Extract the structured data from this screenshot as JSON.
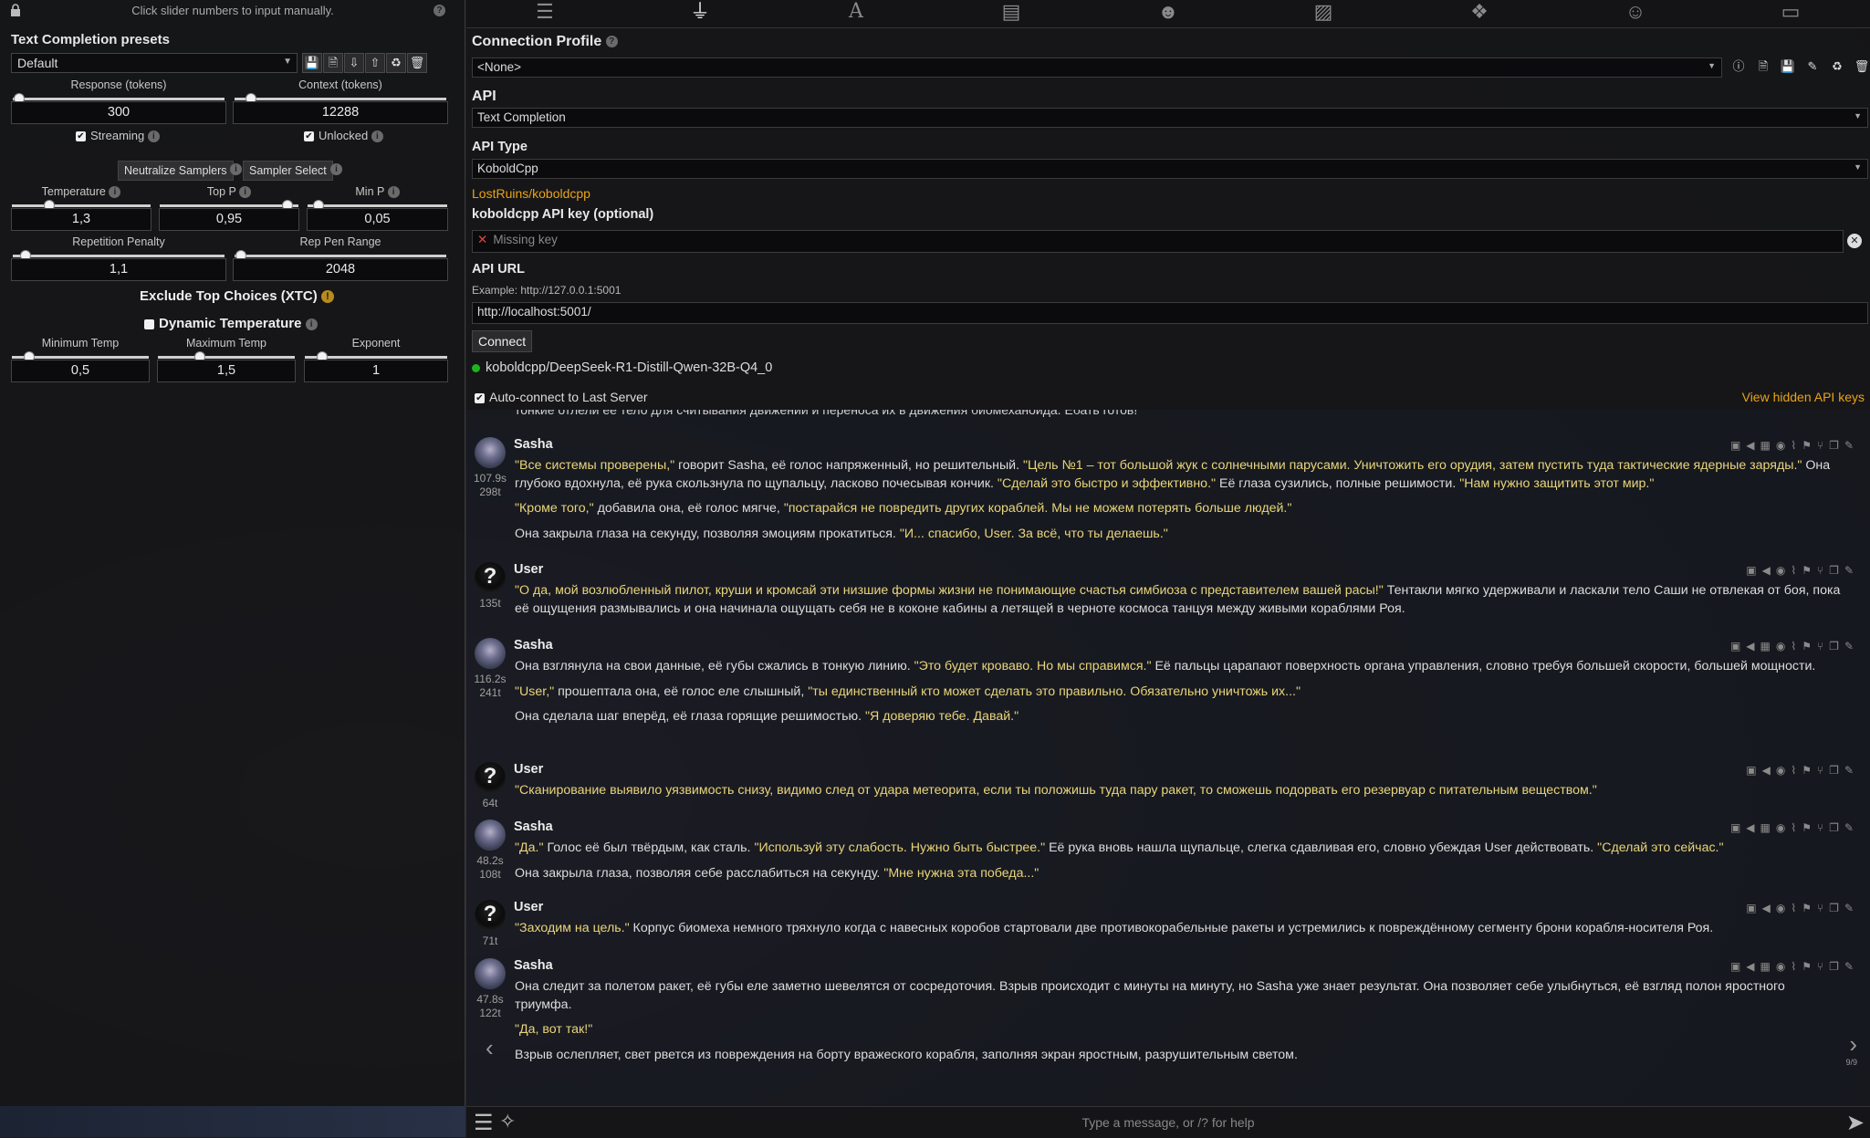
{
  "left_panel": {
    "hint": "Click slider numbers to input manually.",
    "presets_title": "Text Completion presets",
    "preset_value": "Default",
    "response_label": "Response (tokens)",
    "response_value": "300",
    "response_level": 0.05,
    "context_label": "Context (tokens)",
    "context_value": "12288",
    "context_level": 0.08,
    "streaming_label": "Streaming",
    "streaming_checked": true,
    "unlocked_label": "Unlocked",
    "unlocked_checked": true,
    "neutralize_label": "Neutralize Samplers",
    "sampler_select_label": "Sampler Select",
    "temperature_label": "Temperature",
    "temperature_value": "1,3",
    "top_p_label": "Top P",
    "top_p_value": "0,95",
    "min_p_label": "Min P",
    "min_p_value": "0,05",
    "rep_pen_label": "Repetition Penalty",
    "rep_pen_value": "1,1",
    "rep_pen_range_label": "Rep Pen Range",
    "rep_pen_range_value": "2048",
    "xtc_label": "Exclude Top Choices (XTC)",
    "dynamic_temp_label": "Dynamic Temperature",
    "dynamic_temp_checked": false,
    "min_temp_label": "Minimum Temp",
    "min_temp_value": "0,5",
    "max_temp_label": "Maximum Temp",
    "max_temp_value": "1,5",
    "exponent_label": "Exponent",
    "exponent_value": "1"
  },
  "connection": {
    "profile_title": "Connection Profile",
    "profile_value": "<None>",
    "api_title": "API",
    "api_value": "Text Completion",
    "api_type_title": "API Type",
    "api_type_value": "KoboldCpp",
    "repo_link": "LostRuins/koboldcpp",
    "key_title": "koboldcpp API key (optional)",
    "key_placeholder": "Missing key",
    "url_title": "API URL",
    "url_example": "Example: http://127.0.0.1:5001",
    "url_value": "http://localhost:5001/",
    "connect_label": "Connect",
    "model_status": "koboldcpp/DeepSeek-R1-Distill-Qwen-32B-Q4_0",
    "status_color": "#1db31d",
    "autoconnect_label": "Auto-connect to Last Server",
    "autoconnect_checked": true,
    "hidden_keys_label": "View hidden API keys"
  },
  "nav_icons": [
    "sliders-icon",
    "plug-icon",
    "font-icon",
    "book-icon",
    "user-cog-icon",
    "image-icon",
    "cubes-icon",
    "smile-icon",
    "id-card-icon"
  ],
  "chat": {
    "cut_line": "тонкие отлели ее тело для считывания движений и переноса их в движения биомеханоида. Ебать готов!",
    "messages": [
      {
        "name": "Sasha",
        "time": "107.9s",
        "tokens": "298t",
        "paras": [
          [
            {
              "t": "\"Все системы проверены,\"",
              "q": true
            },
            {
              "t": " говорит Sasha, её голос напряженный, но решительный. ",
              "q": false
            },
            {
              "t": "\"Цель №1 – тот большой жук с солнечными парусами. Уничтожить его орудия, затем пустить туда тактические ядерные заряды.\"",
              "q": true
            },
            {
              "t": " Она глубоко вдохнула, её рука скользнула по щупальцу, ласково почесывая кончик. ",
              "q": false
            },
            {
              "t": "\"Сделай это быстро и эффективно.\"",
              "q": true
            },
            {
              "t": " Её глаза сузились, полные решимости. ",
              "q": false
            },
            {
              "t": "\"Нам нужно защитить этот мир.\"",
              "q": true
            }
          ],
          [
            {
              "t": "\"Кроме того,\"",
              "q": true
            },
            {
              "t": " добавила она, её голос мягче, ",
              "q": false
            },
            {
              "t": "\"постарайся не повредить других кораблей. Мы не можем потерять больше людей.\"",
              "q": true
            }
          ],
          [
            {
              "t": "Она закрыла глаза на секунду, позволяя эмоциям прокатиться. ",
              "q": false
            },
            {
              "t": "\"И... спасибо, User. За всё, что ты делаешь.\"",
              "q": true
            }
          ]
        ]
      },
      {
        "name": "User",
        "time": "",
        "tokens": "135t",
        "paras": [
          [
            {
              "t": "\"О да, мой возлюбленный пилот, круши и кромсай эти низшие формы жизни не понимающие счастья симбиоза с представителем вашей расы!\"",
              "q": true
            },
            {
              "t": " Тентакли мягко удерживали и ласкали тело Саши не отвлекая от боя, пока её ощущения размывались и она начинала ощущать себя не в коконе кабины а летящей в черноте космоса танцуя между живыми кораблями Роя.",
              "q": false
            }
          ]
        ]
      },
      {
        "name": "Sasha",
        "time": "116.2s",
        "tokens": "241t",
        "paras": [
          [
            {
              "t": "Она взглянула на свои данные, её губы сжались в тонкую линию. ",
              "q": false
            },
            {
              "t": "\"Это будет кроваво. Но мы справимся.\"",
              "q": true
            },
            {
              "t": " Её пальцы царапают поверхность органа управления, словно требуя большей скорости, большей мощности.",
              "q": false
            }
          ],
          [
            {
              "t": "\"User,\"",
              "q": true
            },
            {
              "t": " прошептала она, её голос еле слышный, ",
              "q": false
            },
            {
              "t": "\"ты единственный кто может сделать это правильно. Обязательно уничтожь их...\"",
              "q": true
            }
          ],
          [
            {
              "t": "Она сделала шаг вперёд, её глаза горящие решимостью. ",
              "q": false
            },
            {
              "t": "\"Я доверяю тебе. Давай.\"",
              "q": true
            }
          ]
        ]
      },
      {
        "name": "User",
        "time": "",
        "tokens": "64t",
        "paras": [
          [
            {
              "t": "\"Сканирование выявило уязвимость снизу, видимо след от удара метеорита, если ты положишь туда пару ракет, то сможешь подорвать его резервуар с питательным веществом.\"",
              "q": true
            }
          ]
        ]
      },
      {
        "name": "Sasha",
        "time": "48.2s",
        "tokens": "108t",
        "paras": [
          [
            {
              "t": "\"Да.\"",
              "q": true
            },
            {
              "t": " Голос её был твёрдым, как сталь. ",
              "q": false
            },
            {
              "t": "\"Используй эту слабость. Нужно быть быстрее.\"",
              "q": true
            },
            {
              "t": " Её рука вновь нашла щупальце, слегка сдавливая его, словно убеждая User действовать. ",
              "q": false
            },
            {
              "t": "\"Сделай это сейчас.\"",
              "q": true
            }
          ],
          [
            {
              "t": "Она закрыла глаза, позволяя себе расслабиться на секунду. ",
              "q": false
            },
            {
              "t": "\"Мне нужна эта победа...\"",
              "q": true
            }
          ]
        ]
      },
      {
        "name": "User",
        "time": "",
        "tokens": "71t",
        "paras": [
          [
            {
              "t": "\"Заходим на цель.\"",
              "q": true
            },
            {
              "t": " Корпус биомеха немного тряхнуло когда с навесных коробов стартовали две противокорабельные ракеты и устремились к повреждённому сегменту брони корабля-носителя Роя.",
              "q": false
            }
          ]
        ]
      },
      {
        "name": "Sasha",
        "time": "47.8s",
        "tokens": "122t",
        "paras": [
          [
            {
              "t": "Она следит за полетом ракет, её губы еле заметно шевелятся от сосредоточия. Взрыв происходит с минуты на минуту, но Sasha уже знает результат. Она позволяет себе улыбнуться, её взгляд полон яростного триумфа.",
              "q": false
            }
          ],
          [
            {
              "t": "\"Да, вот так!\"",
              "q": true
            }
          ],
          [
            {
              "t": "Взрыв ослепляет, свет рвется из повреждения на борту вражеского корабля, заполняя экран яростным, разрушительным светом.",
              "q": false
            }
          ]
        ]
      }
    ],
    "swipe_counter": "9/9"
  },
  "input": {
    "placeholder": "Type a message, or /? for help"
  }
}
